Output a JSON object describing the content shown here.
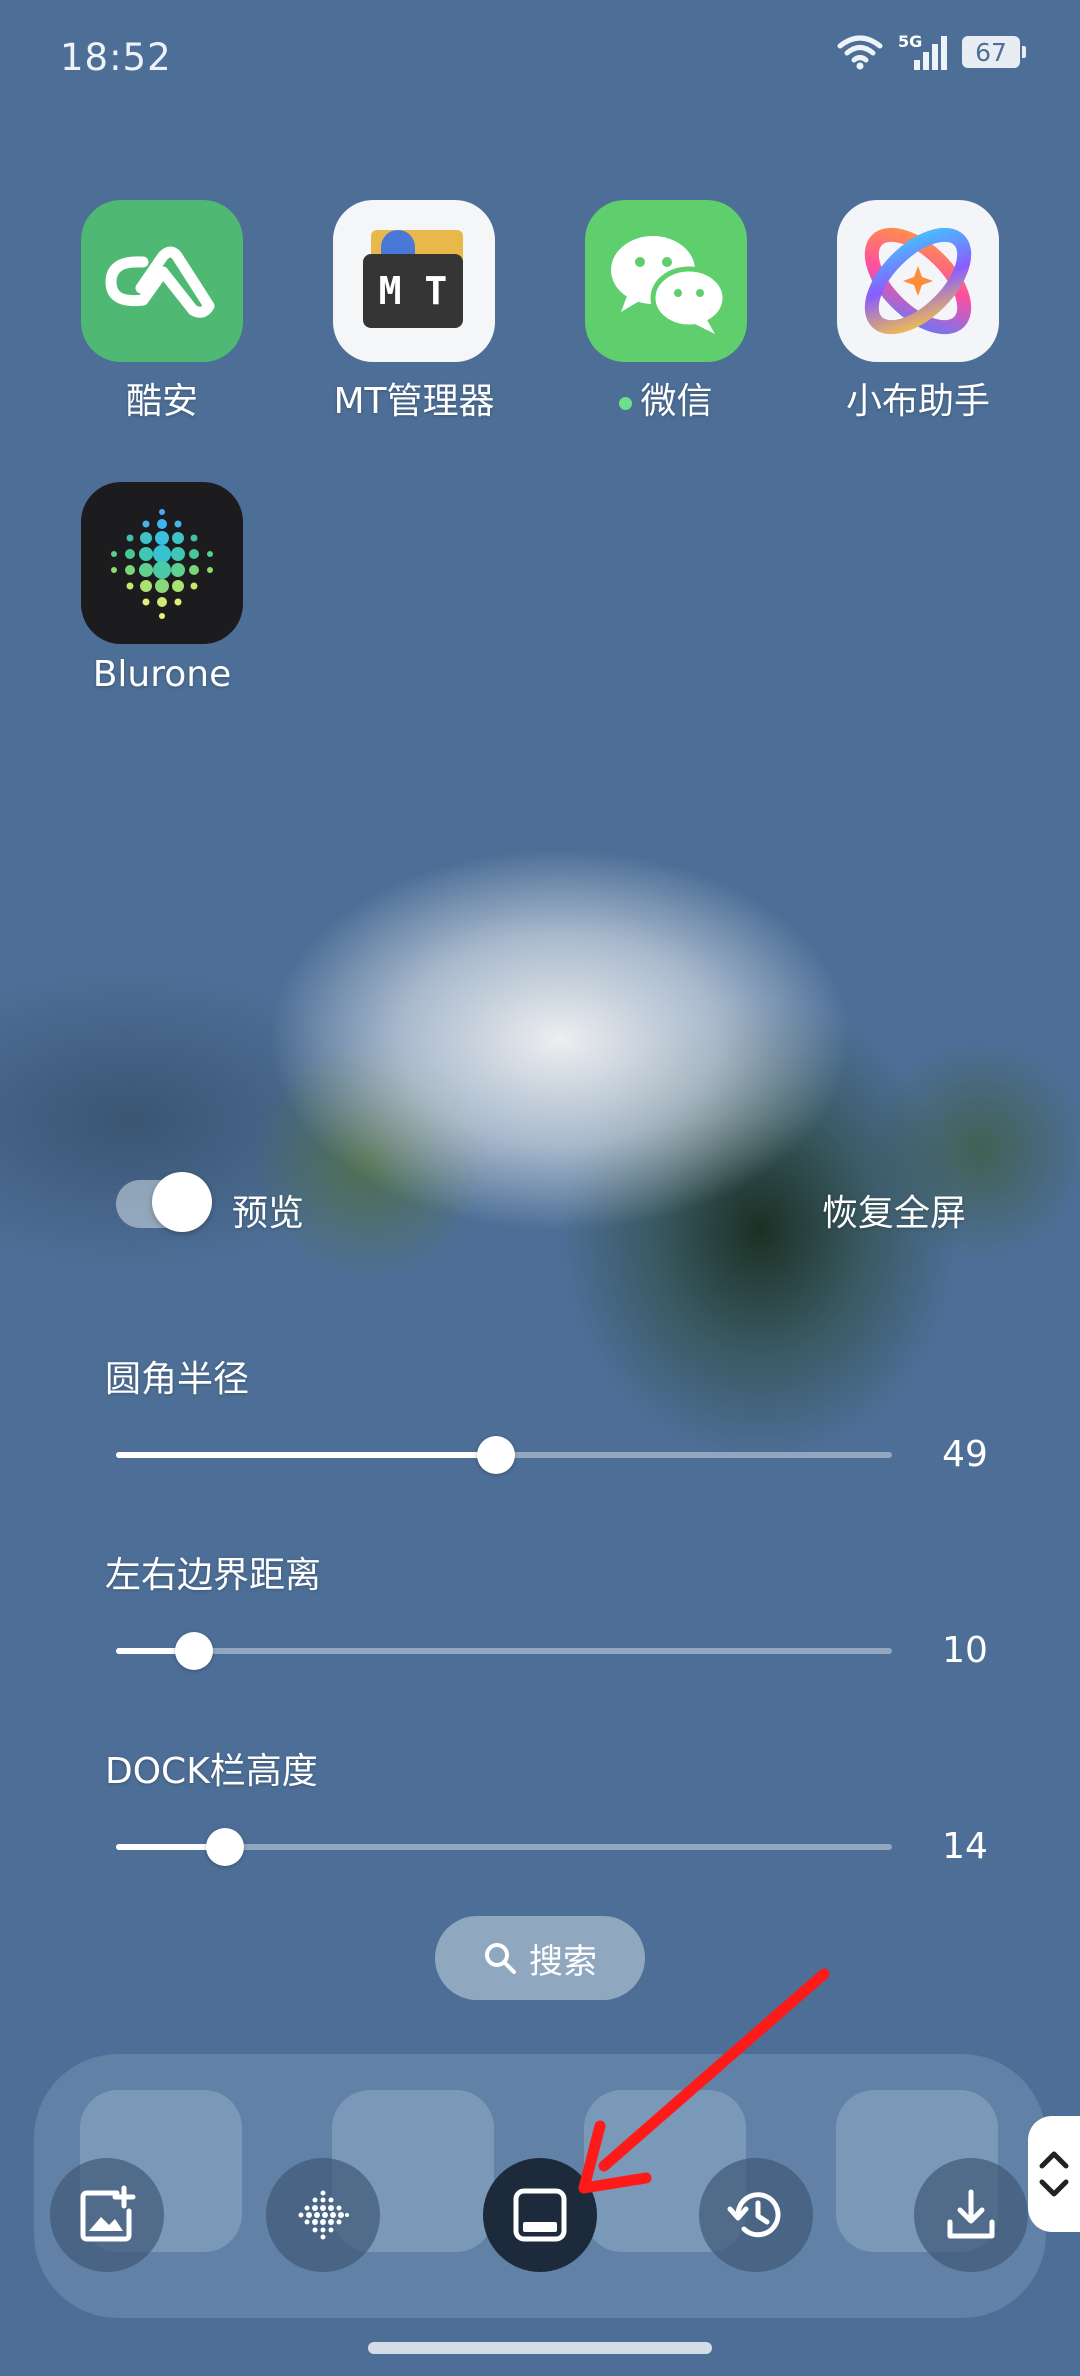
{
  "status_bar": {
    "time": "18:52",
    "network": "5G",
    "battery": "67"
  },
  "apps": [
    {
      "label": "酷安"
    },
    {
      "label": "MT管理器",
      "icon_text": "M T"
    },
    {
      "label": "微信"
    },
    {
      "label": "小布助手"
    },
    {
      "label": "Blurone"
    }
  ],
  "controls": {
    "preview_label": "预览",
    "restore_label": "恢复全屏",
    "preview_enabled": true
  },
  "sliders": [
    {
      "label": "圆角半径",
      "value": "49",
      "fraction": 0.49
    },
    {
      "label": "左右边界距离",
      "value": "10",
      "fraction": 0.1
    },
    {
      "label": "DOCK栏高度",
      "value": "14",
      "fraction": 0.14
    }
  ],
  "search": {
    "label": "搜索"
  },
  "toolbar": {
    "items": [
      "add-image-icon",
      "blur-dots-icon",
      "dock-layout-icon",
      "history-icon",
      "download-icon"
    ],
    "active_index": 2
  },
  "colors": {
    "background": "#4d6f97",
    "accent_arrow": "#ff1a1a"
  }
}
